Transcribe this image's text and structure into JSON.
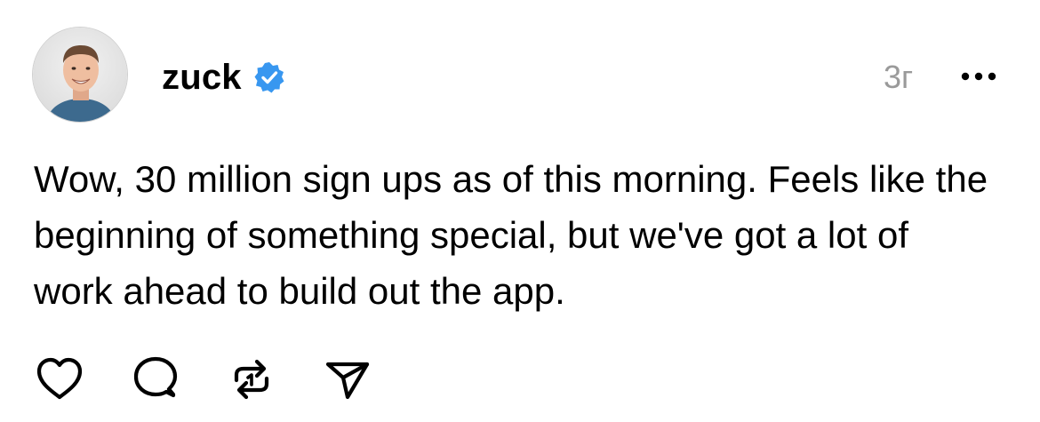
{
  "post": {
    "author": {
      "username": "zuck",
      "verified": true,
      "verified_icon": "verified-badge-icon",
      "verified_color": "#3897f0",
      "avatar_icon": "profile-photo-avatar"
    },
    "timestamp": "3г",
    "more_icon": "more-options-icon",
    "text": "Wow, 30 million sign ups as of this morning. Feels like the beginning of something special, but we've got a lot of work ahead to build out the app.",
    "actions": [
      {
        "name": "like",
        "icon": "heart-icon"
      },
      {
        "name": "reply",
        "icon": "comment-icon"
      },
      {
        "name": "repost",
        "icon": "repost-icon"
      },
      {
        "name": "share",
        "icon": "send-icon"
      }
    ]
  }
}
